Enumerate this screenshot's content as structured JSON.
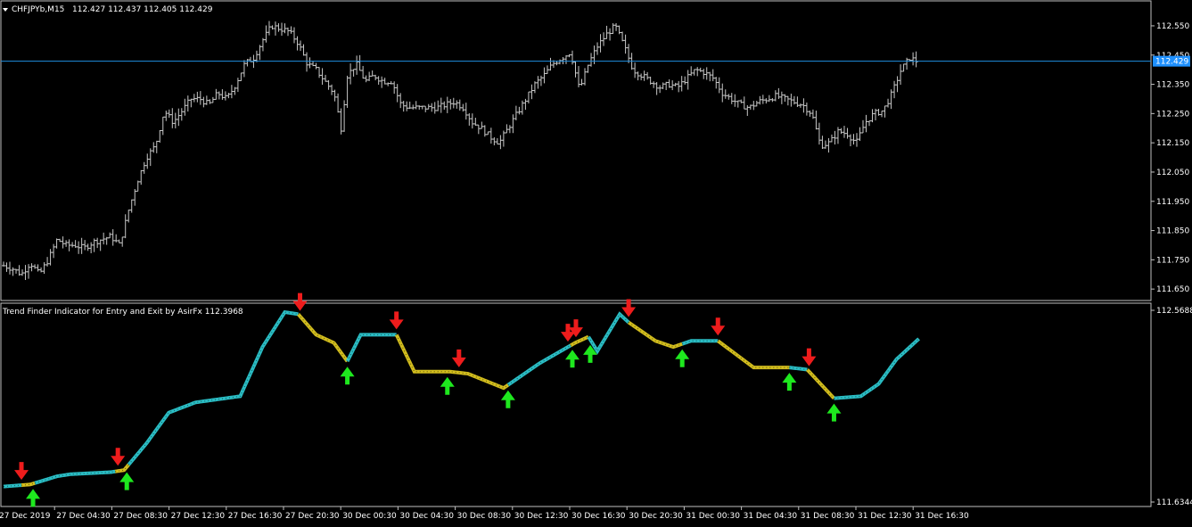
{
  "main_header": {
    "symbol": "CHFJPYb,M15",
    "ohlc": "112.427 112.437 112.405 112.429",
    "current_price_label": "112.429"
  },
  "indicator_header": {
    "title": "Trend Finder Indicator for Entry and Exit by AsirFx 112.3968"
  },
  "colors": {
    "background": "#000000",
    "bars": "#c8c8c8",
    "frame": "#c0c0c0",
    "price_line": "#1f8fe0",
    "price_label_bg": "#1e90ff",
    "trend_up": "#2fd0d8",
    "trend_down": "#e8d020",
    "arrow_up": "#1ee81e",
    "arrow_down": "#ee1c1c"
  },
  "icons": {
    "buy_signal": "green-up-arrow-icon",
    "sell_signal": "red-down-arrow-icon",
    "menu": "triangle-down-icon"
  },
  "chart_data": [
    {
      "type": "ohlc",
      "name": "CHFJPYb,M15",
      "ylim": [
        111.62,
        112.62
      ],
      "y_ticks": [
        "112.550",
        "112.450",
        "112.350",
        "112.250",
        "112.150",
        "112.050",
        "111.950",
        "111.850",
        "111.750",
        "111.650"
      ],
      "x_ticks": [
        "27 Dec 2019",
        "27 Dec 04:30",
        "27 Dec 08:30",
        "27 Dec 12:30",
        "27 Dec 16:30",
        "27 Dec 20:30",
        "30 Dec 00:30",
        "30 Dec 04:30",
        "30 Dec 08:30",
        "30 Dec 12:30",
        "30 Dec 16:30",
        "30 Dec 20:30",
        "31 Dec 00:30",
        "31 Dec 04:30",
        "31 Dec 08:30",
        "31 Dec 12:30",
        "31 Dec 16:30"
      ],
      "current_price": 112.429,
      "close_path": [
        [
          0,
          111.73
        ],
        [
          10,
          111.72
        ],
        [
          20,
          111.7
        ],
        [
          30,
          111.74
        ],
        [
          40,
          111.7
        ],
        [
          50,
          111.75
        ],
        [
          60,
          111.82
        ],
        [
          70,
          111.8
        ],
        [
          80,
          111.8
        ],
        [
          90,
          111.79
        ],
        [
          100,
          111.81
        ],
        [
          110,
          111.82
        ],
        [
          120,
          111.83
        ],
        [
          130,
          111.8
        ],
        [
          140,
          111.92
        ],
        [
          150,
          112.02
        ],
        [
          160,
          112.1
        ],
        [
          170,
          112.14
        ],
        [
          180,
          112.26
        ],
        [
          190,
          112.22
        ],
        [
          200,
          112.26
        ],
        [
          210,
          112.3
        ],
        [
          220,
          112.3
        ],
        [
          230,
          112.28
        ],
        [
          240,
          112.32
        ],
        [
          250,
          112.3
        ],
        [
          260,
          112.35
        ],
        [
          270,
          112.42
        ],
        [
          280,
          112.44
        ],
        [
          290,
          112.5
        ],
        [
          300,
          112.55
        ],
        [
          310,
          112.54
        ],
        [
          320,
          112.53
        ],
        [
          330,
          112.49
        ],
        [
          340,
          112.42
        ],
        [
          350,
          112.4
        ],
        [
          360,
          112.36
        ],
        [
          370,
          112.32
        ],
        [
          378,
          112.2
        ],
        [
          385,
          112.38
        ],
        [
          395,
          112.42
        ],
        [
          405,
          112.36
        ],
        [
          415,
          112.38
        ],
        [
          425,
          112.36
        ],
        [
          435,
          112.36
        ],
        [
          445,
          112.28
        ],
        [
          455,
          112.27
        ],
        [
          465,
          112.27
        ],
        [
          475,
          112.27
        ],
        [
          485,
          112.27
        ],
        [
          495,
          112.28
        ],
        [
          505,
          112.29
        ],
        [
          515,
          112.27
        ],
        [
          525,
          112.22
        ],
        [
          535,
          112.2
        ],
        [
          545,
          112.17
        ],
        [
          555,
          112.15
        ],
        [
          565,
          112.2
        ],
        [
          575,
          112.25
        ],
        [
          585,
          112.3
        ],
        [
          595,
          112.35
        ],
        [
          605,
          112.38
        ],
        [
          615,
          112.42
        ],
        [
          625,
          112.44
        ],
        [
          635,
          112.46
        ],
        [
          645,
          112.33
        ],
        [
          655,
          112.42
        ],
        [
          665,
          112.48
        ],
        [
          675,
          112.52
        ],
        [
          685,
          112.55
        ],
        [
          695,
          112.48
        ],
        [
          705,
          112.4
        ],
        [
          715,
          112.38
        ],
        [
          725,
          112.36
        ],
        [
          735,
          112.34
        ],
        [
          745,
          112.35
        ],
        [
          755,
          112.34
        ],
        [
          765,
          112.37
        ],
        [
          775,
          112.4
        ],
        [
          785,
          112.39
        ],
        [
          795,
          112.37
        ],
        [
          805,
          112.32
        ],
        [
          815,
          112.3
        ],
        [
          825,
          112.28
        ],
        [
          835,
          112.27
        ],
        [
          845,
          112.29
        ],
        [
          855,
          112.3
        ],
        [
          865,
          112.31
        ],
        [
          875,
          112.3
        ],
        [
          885,
          112.29
        ],
        [
          895,
          112.28
        ],
        [
          905,
          112.25
        ],
        [
          915,
          112.14
        ],
        [
          925,
          112.15
        ],
        [
          935,
          112.19
        ],
        [
          945,
          112.18
        ],
        [
          955,
          112.15
        ],
        [
          965,
          112.22
        ],
        [
          975,
          112.25
        ],
        [
          985,
          112.26
        ],
        [
          995,
          112.32
        ],
        [
          1005,
          112.4
        ],
        [
          1015,
          112.44
        ],
        [
          1022,
          112.43
        ]
      ]
    },
    {
      "type": "line",
      "name": "Trend Finder",
      "ylim": [
        111.6344,
        112.5688
      ],
      "y_ticks": [
        "112.5688",
        "111.6344"
      ],
      "x": [
        0,
        30,
        60,
        75,
        120,
        135,
        160,
        185,
        215,
        265,
        290,
        315,
        330,
        350,
        370,
        385,
        400,
        440,
        460,
        500,
        520,
        560,
        600,
        640,
        655,
        665,
        690,
        700,
        730,
        750,
        770,
        800,
        840,
        880,
        900,
        930,
        960,
        980,
        1000,
        1025
      ],
      "values": [
        111.71,
        111.72,
        111.76,
        111.77,
        111.78,
        111.79,
        111.92,
        112.07,
        112.12,
        112.15,
        112.39,
        112.56,
        112.55,
        112.45,
        112.41,
        112.32,
        112.45,
        112.45,
        112.27,
        112.27,
        112.26,
        112.19,
        112.31,
        112.41,
        112.44,
        112.37,
        112.55,
        112.51,
        112.42,
        112.39,
        112.42,
        112.42,
        112.29,
        112.29,
        112.28,
        112.14,
        112.15,
        112.21,
        112.33,
        112.43
      ],
      "trend_segments": [
        {
          "from": 0,
          "to": 20,
          "dir": "up"
        },
        {
          "from": 20,
          "to": 35,
          "dir": "down"
        },
        {
          "from": 35,
          "to": 125,
          "dir": "up"
        },
        {
          "from": 125,
          "to": 140,
          "dir": "down"
        },
        {
          "from": 140,
          "to": 330,
          "dir": "up"
        },
        {
          "from": 330,
          "to": 385,
          "dir": "down"
        },
        {
          "from": 385,
          "to": 440,
          "dir": "up"
        },
        {
          "from": 440,
          "to": 565,
          "dir": "down"
        },
        {
          "from": 565,
          "to": 635,
          "dir": "up"
        },
        {
          "from": 635,
          "to": 655,
          "dir": "down"
        },
        {
          "from": 655,
          "to": 700,
          "dir": "up"
        },
        {
          "from": 700,
          "to": 760,
          "dir": "down"
        },
        {
          "from": 760,
          "to": 800,
          "dir": "up"
        },
        {
          "from": 800,
          "to": 880,
          "dir": "down"
        },
        {
          "from": 880,
          "to": 900,
          "dir": "up"
        },
        {
          "from": 900,
          "to": 930,
          "dir": "down"
        },
        {
          "from": 930,
          "to": 1025,
          "dir": "up"
        }
      ],
      "signals": [
        {
          "x": 20,
          "type": "sell"
        },
        {
          "x": 33,
          "type": "buy"
        },
        {
          "x": 128,
          "type": "sell"
        },
        {
          "x": 138,
          "type": "buy"
        },
        {
          "x": 332,
          "type": "sell"
        },
        {
          "x": 385,
          "type": "buy"
        },
        {
          "x": 440,
          "type": "sell"
        },
        {
          "x": 497,
          "type": "buy"
        },
        {
          "x": 510,
          "type": "sell"
        },
        {
          "x": 565,
          "type": "buy"
        },
        {
          "x": 632,
          "type": "sell"
        },
        {
          "x": 641,
          "type": "sell"
        },
        {
          "x": 637,
          "type": "buy"
        },
        {
          "x": 657,
          "type": "buy"
        },
        {
          "x": 700,
          "type": "sell"
        },
        {
          "x": 760,
          "type": "buy"
        },
        {
          "x": 800,
          "type": "sell"
        },
        {
          "x": 880,
          "type": "buy"
        },
        {
          "x": 902,
          "type": "sell"
        },
        {
          "x": 930,
          "type": "buy"
        }
      ]
    }
  ]
}
